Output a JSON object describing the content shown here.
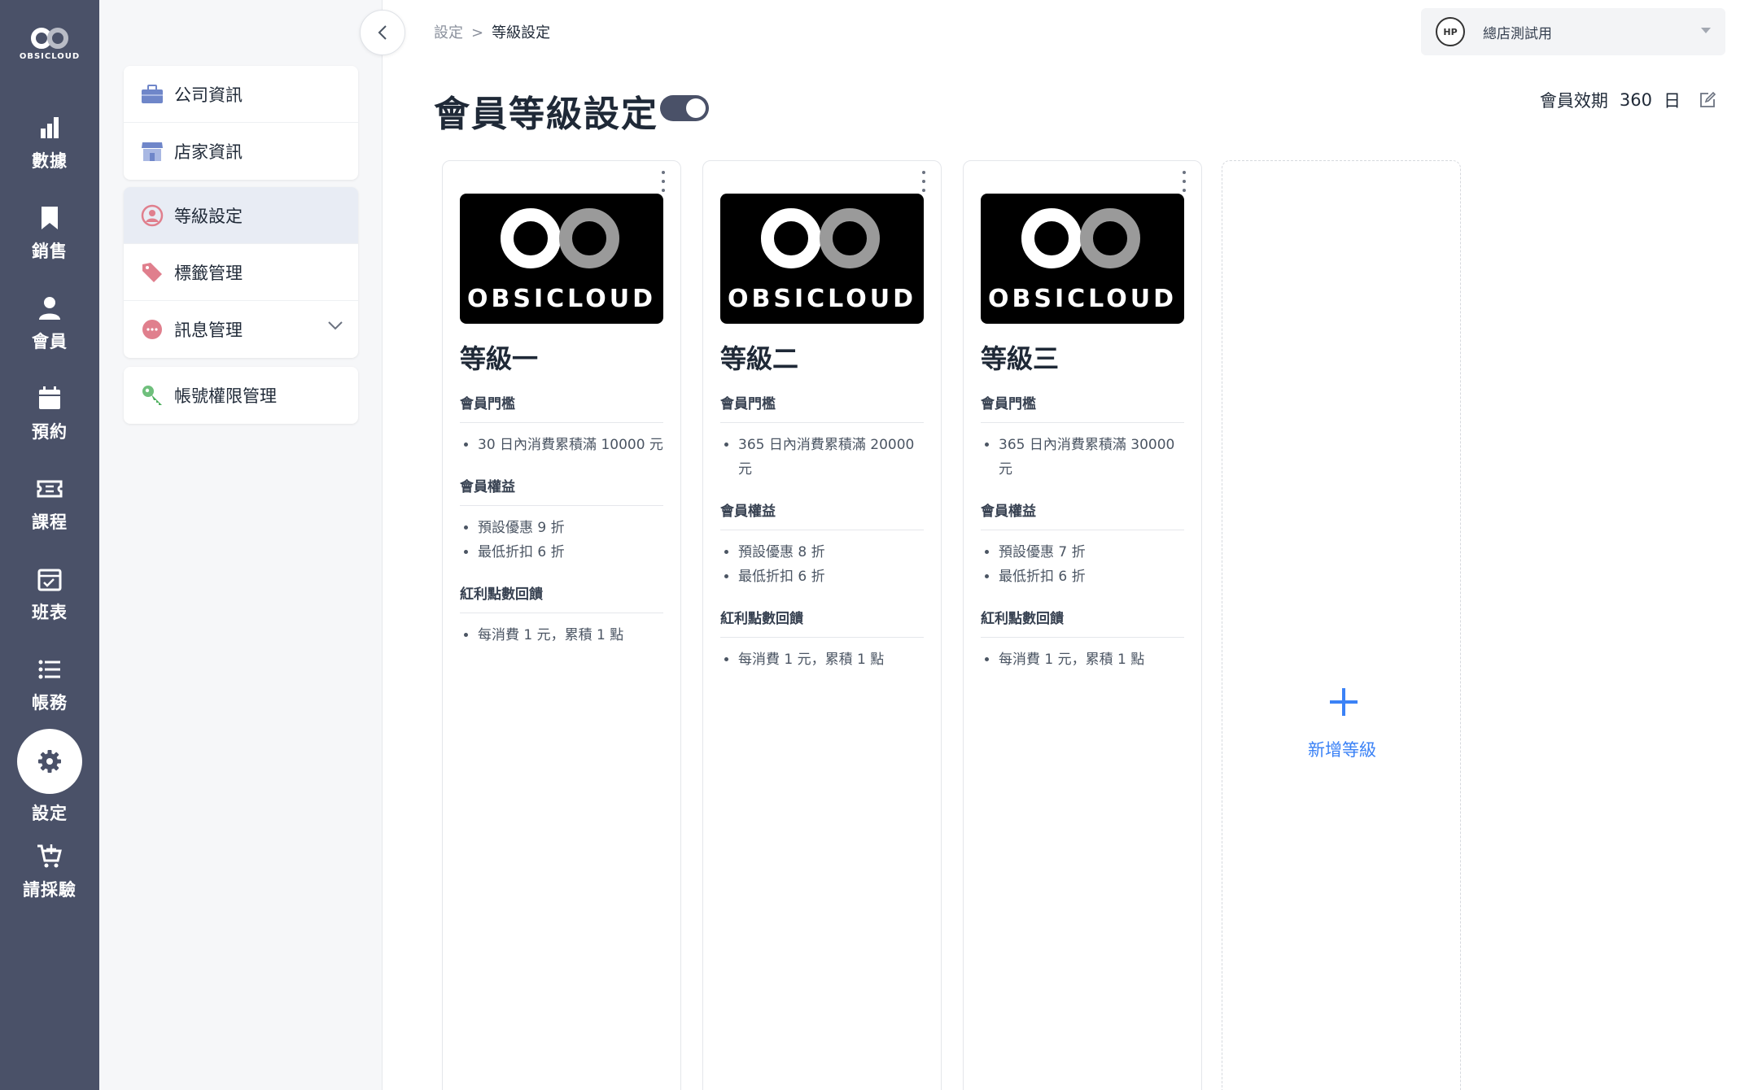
{
  "brand": {
    "logo_text": "OBSICLOUD"
  },
  "nav": {
    "items": [
      {
        "label": "數據",
        "icon": "bar-chart-icon"
      },
      {
        "label": "銷售",
        "icon": "bookmark-icon"
      },
      {
        "label": "會員",
        "icon": "person-icon"
      },
      {
        "label": "預約",
        "icon": "calendar-icon"
      },
      {
        "label": "課程",
        "icon": "ticket-icon"
      },
      {
        "label": "班表",
        "icon": "schedule-icon"
      },
      {
        "label": "帳務",
        "icon": "list-icon"
      },
      {
        "label": "設定",
        "icon": "gear-icon",
        "active": true
      },
      {
        "label": "請採驗",
        "icon": "cart-icon"
      }
    ]
  },
  "submenu": {
    "group1": [
      {
        "label": "公司資訊",
        "icon": "briefcase-icon"
      },
      {
        "label": "店家資訊",
        "icon": "store-icon"
      }
    ],
    "group2": [
      {
        "label": "等級設定",
        "icon": "member-level-icon",
        "active": true
      },
      {
        "label": "標籤管理",
        "icon": "tag-icon"
      },
      {
        "label": "訊息管理",
        "icon": "message-icon",
        "expandable": true
      }
    ],
    "group3": [
      {
        "label": "帳號權限管理",
        "icon": "key-icon"
      }
    ]
  },
  "breadcrumb": {
    "root": "設定",
    "separator": ">",
    "current": "等級設定"
  },
  "store": {
    "avatar_text": "HP",
    "name": "總店測試用"
  },
  "page": {
    "title": "會員等級設定",
    "toggle_on": true,
    "validity_label": "會員效期",
    "validity_value": "360",
    "validity_unit": "日"
  },
  "levels": [
    {
      "name": "等級一",
      "threshold_title": "會員門檻",
      "threshold": [
        "30 日內消費累積滿 10000 元"
      ],
      "benefits_title": "會員權益",
      "benefits": [
        "預設優惠 9 折",
        "最低折扣 6 折"
      ],
      "points_title": "紅利點數回饋",
      "points": [
        "每消費 1 元，累積 1 點"
      ]
    },
    {
      "name": "等級二",
      "threshold_title": "會員門檻",
      "threshold": [
        "365 日內消費累積滿 20000 元"
      ],
      "benefits_title": "會員權益",
      "benefits": [
        "預設優惠 8 折",
        "最低折扣 6 折"
      ],
      "points_title": "紅利點數回饋",
      "points": [
        "每消費 1 元，累積 1 點"
      ]
    },
    {
      "name": "等級三",
      "threshold_title": "會員門檻",
      "threshold": [
        "365 日內消費累積滿 30000 元"
      ],
      "benefits_title": "會員權益",
      "benefits": [
        "預設優惠 7 折",
        "最低折扣 6 折"
      ],
      "points_title": "紅利點數回饋",
      "points": [
        "每消費 1 元，累積 1 點"
      ]
    }
  ],
  "add_level_label": "新增等級",
  "colors": {
    "nav_bg": "#4a5168",
    "accent": "#3b82f6",
    "active_sub_bg": "#e8ecf4"
  }
}
